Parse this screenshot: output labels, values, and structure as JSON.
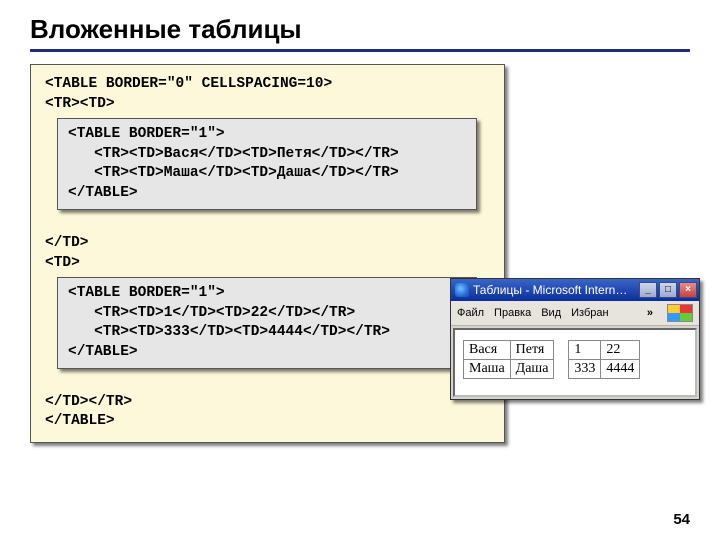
{
  "title": "Вложенные таблицы",
  "page_number": "54",
  "outer_code": {
    "line1": "<TABLE BORDER=\"0\" CELLSPACING=10>",
    "line2": "<TR><TD>",
    "line3": "</TD>",
    "line4": "<TD>",
    "line5": "</TD></TR>",
    "line6": "</TABLE>"
  },
  "inner_code_1": {
    "l1": "<TABLE BORDER=\"1\">",
    "l2": "   <TR><TD>Вася</TD><TD>Петя</TD></TR>",
    "l3": "   <TR><TD>Маша</TD><TD>Даша</TD></TR>",
    "l4": "</TABLE>"
  },
  "inner_code_2": {
    "l1": "<TABLE BORDER=\"1\">",
    "l2": "   <TR><TD>1</TD><TD>22</TD></TR>",
    "l3": "   <TR><TD>333</TD><TD>4444</TD></TR>",
    "l4": "</TABLE>"
  },
  "browser": {
    "title": "Таблицы - Microsoft Intern…",
    "menu": {
      "file": "Файл",
      "edit": "Правка",
      "view": "Вид",
      "fav": "Избран",
      "more": "»"
    },
    "btn_min": "_",
    "btn_max": "□",
    "btn_close": "×"
  },
  "table1": {
    "r1c1": "Вася",
    "r1c2": "Петя",
    "r2c1": "Маша",
    "r2c2": "Даша"
  },
  "table2": {
    "r1c1": "1",
    "r1c2": "22",
    "r2c1": "333",
    "r2c2": "4444"
  }
}
